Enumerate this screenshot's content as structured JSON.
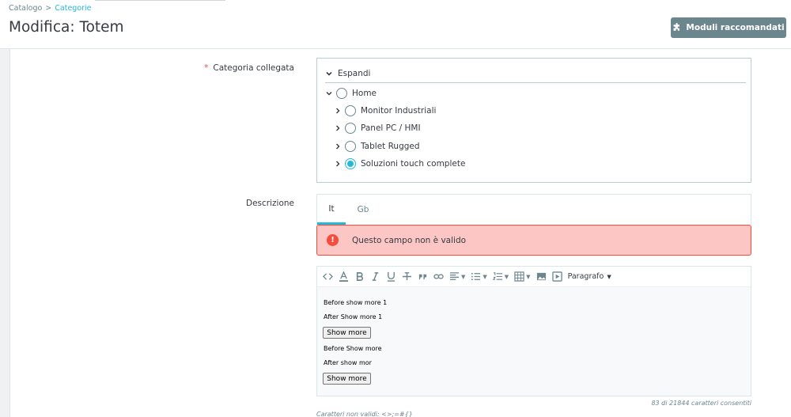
{
  "breadcrumb": {
    "parent": "Catalogo",
    "separator": ">",
    "current": "Categorie"
  },
  "page_title": "Modifica: Totem",
  "header_button": {
    "label": "Moduli raccomandati",
    "icon": "puzzle-icon"
  },
  "form": {
    "category_label": "Categoria collegata",
    "required_mark": "*",
    "description_label": "Descrizione"
  },
  "tree": {
    "expand_label": "Espandi",
    "root": "Home",
    "items": [
      {
        "label": "Monitor Industriali",
        "checked": false
      },
      {
        "label": "Panel PC / HMI",
        "checked": false
      },
      {
        "label": "Tablet Rugged",
        "checked": false
      },
      {
        "label": "Soluzioni touch complete",
        "checked": true
      }
    ]
  },
  "lang_tabs": [
    {
      "label": "It",
      "active": true
    },
    {
      "label": "Gb",
      "active": false
    }
  ],
  "alert": {
    "icon": "!",
    "message": "Questo campo non è valido"
  },
  "editor": {
    "paragraph_label": "Paragrafo",
    "toolbar_icons": [
      "code-icon",
      "text-color-icon",
      "bold-icon",
      "italic-icon",
      "underline-icon",
      "strikethrough-icon",
      "blockquote-icon",
      "link-icon",
      "align-icon",
      "bullet-list-icon",
      "numbered-list-icon",
      "table-icon",
      "image-icon",
      "media-icon"
    ],
    "lines": [
      "Before show more 1",
      "After Show more 1",
      "Before Show more",
      "After show mor"
    ],
    "show_more_label": "Show more"
  },
  "counter": "83 di 21844 caratteri consentiti",
  "invalid_chars": "Caratteri non validi: <>;=#{}",
  "colors": {
    "accent": "#25b9d7",
    "danger": "#f54c3e",
    "button": "#6c868e",
    "alert_bg": "#fbc6c3"
  }
}
